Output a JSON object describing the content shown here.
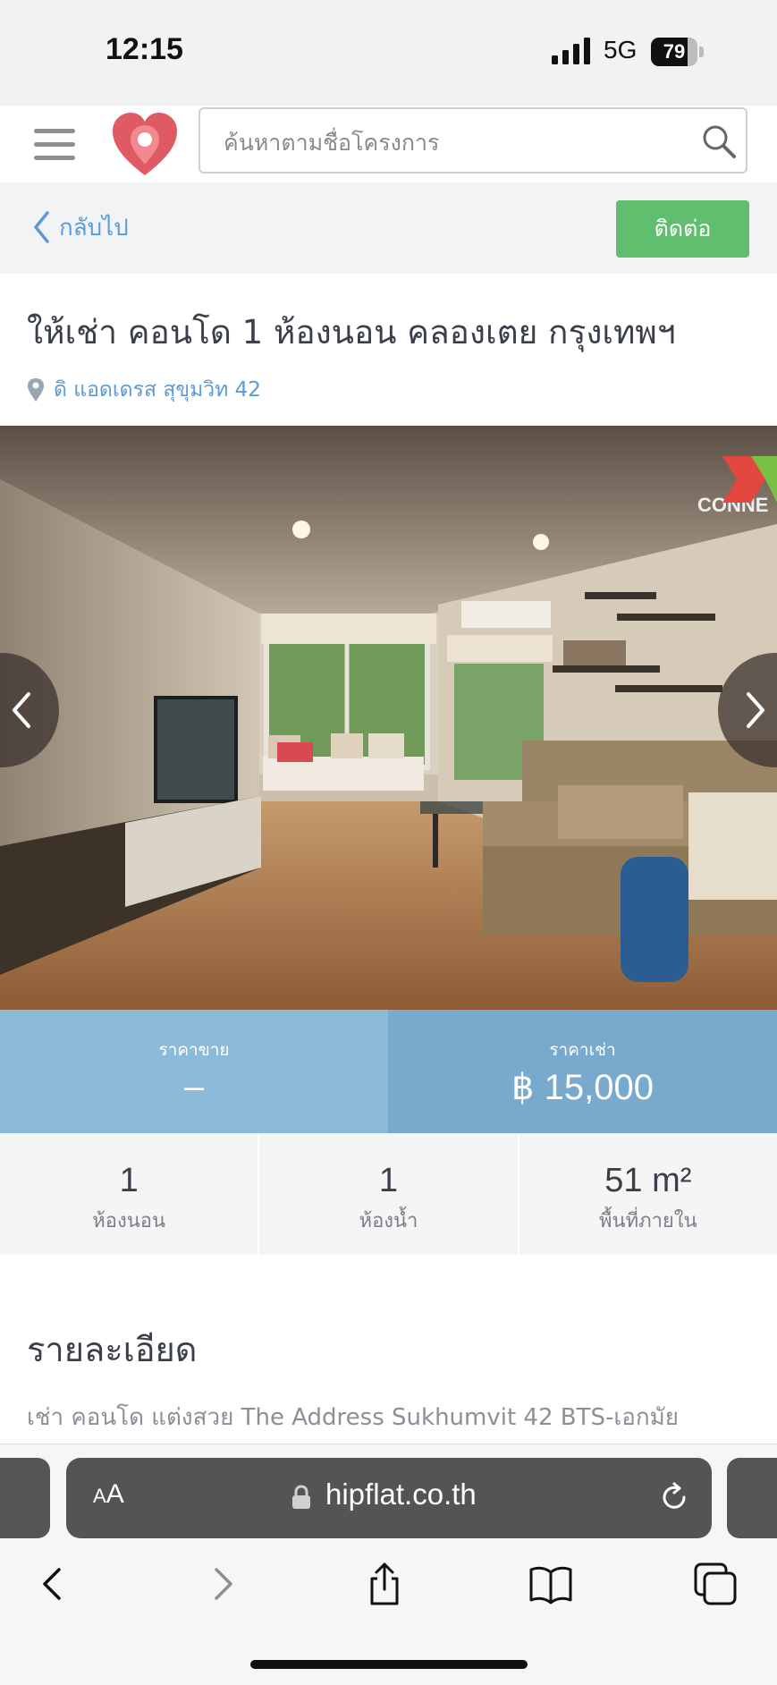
{
  "status_bar": {
    "time": "12:15",
    "network": "5G",
    "battery": 79
  },
  "header": {
    "search_placeholder": "ค้นหาตามชื่อโครงการ"
  },
  "subbar": {
    "back_label": "กลับไป",
    "contact_label": "ติดต่อ"
  },
  "listing": {
    "title": "ให้เช่า คอนโด 1 ห้องนอน คลองเตย กรุงเทพฯ",
    "location": "ดิ แอดเดรส สุขุมวิท 42",
    "watermark": "CONNEX PROPERTY"
  },
  "prices": {
    "sale_label": "ราคาขาย",
    "sale_value": "–",
    "rent_label": "ราคาเช่า",
    "rent_value": "฿ 15,000"
  },
  "specs": [
    {
      "value": "1",
      "label": "ห้องนอน"
    },
    {
      "value": "1",
      "label": "ห้องน้ำ"
    },
    {
      "value": "51 m²",
      "label": "พื้นที่ภายใน"
    }
  ],
  "details": {
    "heading": "รายละเอียด",
    "text": "เช่า คอนโด แต่งสวย The Address Sukhumvit 42 BTS-เอกมัย"
  },
  "browser": {
    "aa_small": "A",
    "aa_big": "A",
    "url": "hipflat.co.th"
  },
  "colors": {
    "accent_blue": "#5b9bd5",
    "contact_green": "#5fbf6f",
    "sale_panel": "#8bbbd8",
    "rent_panel": "#78aacd"
  }
}
